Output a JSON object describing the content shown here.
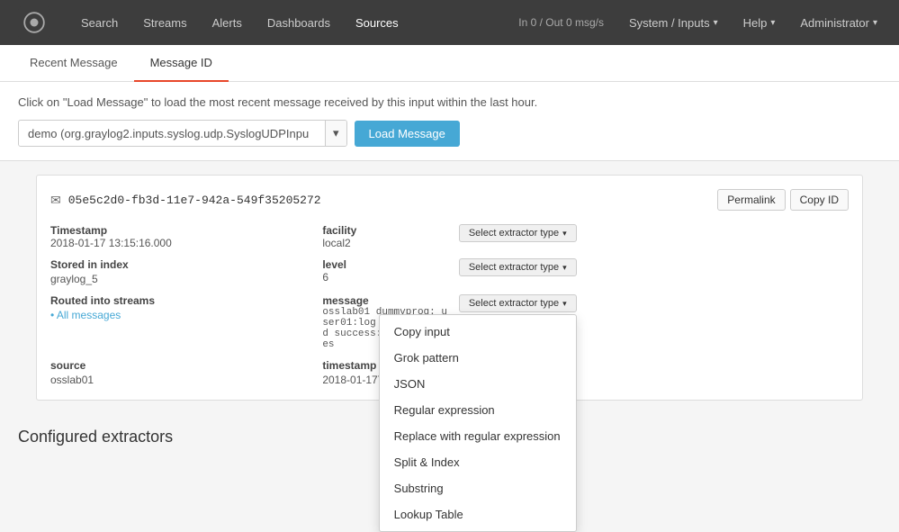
{
  "brand": {
    "name": "Graylog"
  },
  "navbar": {
    "items": [
      {
        "label": "Search",
        "active": false
      },
      {
        "label": "Streams",
        "active": false
      },
      {
        "label": "Alerts",
        "active": false
      },
      {
        "label": "Dashboards",
        "active": false
      },
      {
        "label": "Sources",
        "active": true
      }
    ],
    "system_label": "System / Inputs",
    "in_out": "In 0 / Out 0 msg/s",
    "help_label": "Help",
    "admin_label": "Administrator"
  },
  "tabs": [
    {
      "label": "Recent Message",
      "active": false
    },
    {
      "label": "Message ID",
      "active": true
    }
  ],
  "hint": "Click on \"Load Message\" to load the most recent message received by this input within the last hour.",
  "load": {
    "input_value": "demo (org.graylog2.inputs.syslog.udp.SyslogUDPInpu",
    "button_label": "Load Message"
  },
  "message": {
    "id": "05e5c2d0-fb3d-11e7-942a-549f35205272",
    "permalink_label": "Permalink",
    "copy_id_label": "Copy ID",
    "fields": [
      {
        "label": "Timestamp",
        "value": "2018-01-17 13:15:16.000",
        "extractor": true,
        "extractor_label": "Select extractor type"
      },
      {
        "label": "facility",
        "value": "local2",
        "extractor": true,
        "extractor_label": "Select extractor type"
      },
      {
        "label": "Stored in index",
        "value": "graylog_5",
        "extractor": false
      },
      {
        "label": "level",
        "value": "6",
        "extractor": true,
        "extractor_label": "Select extractor type"
      },
      {
        "label": "Routed into streams",
        "value": "All messages",
        "extractor": false,
        "is_link": true
      },
      {
        "label": "message",
        "value": "osslab01 dummyprog: user01:log message:send success: 210504 bytes",
        "extractor": true,
        "extractor_label": "Select extractor type"
      },
      {
        "label": "source",
        "value": "osslab01",
        "extractor": false
      },
      {
        "label": "timestamp",
        "value": "2018-01-17T04:15:16.000Z",
        "extractor": false
      }
    ]
  },
  "dropdown": {
    "items": [
      "Copy input",
      "Grok pattern",
      "JSON",
      "Regular expression",
      "Replace with regular expression",
      "Split & Index",
      "Substring",
      "Lookup Table"
    ]
  },
  "configured_extractors": {
    "title": "Configured extractors"
  }
}
